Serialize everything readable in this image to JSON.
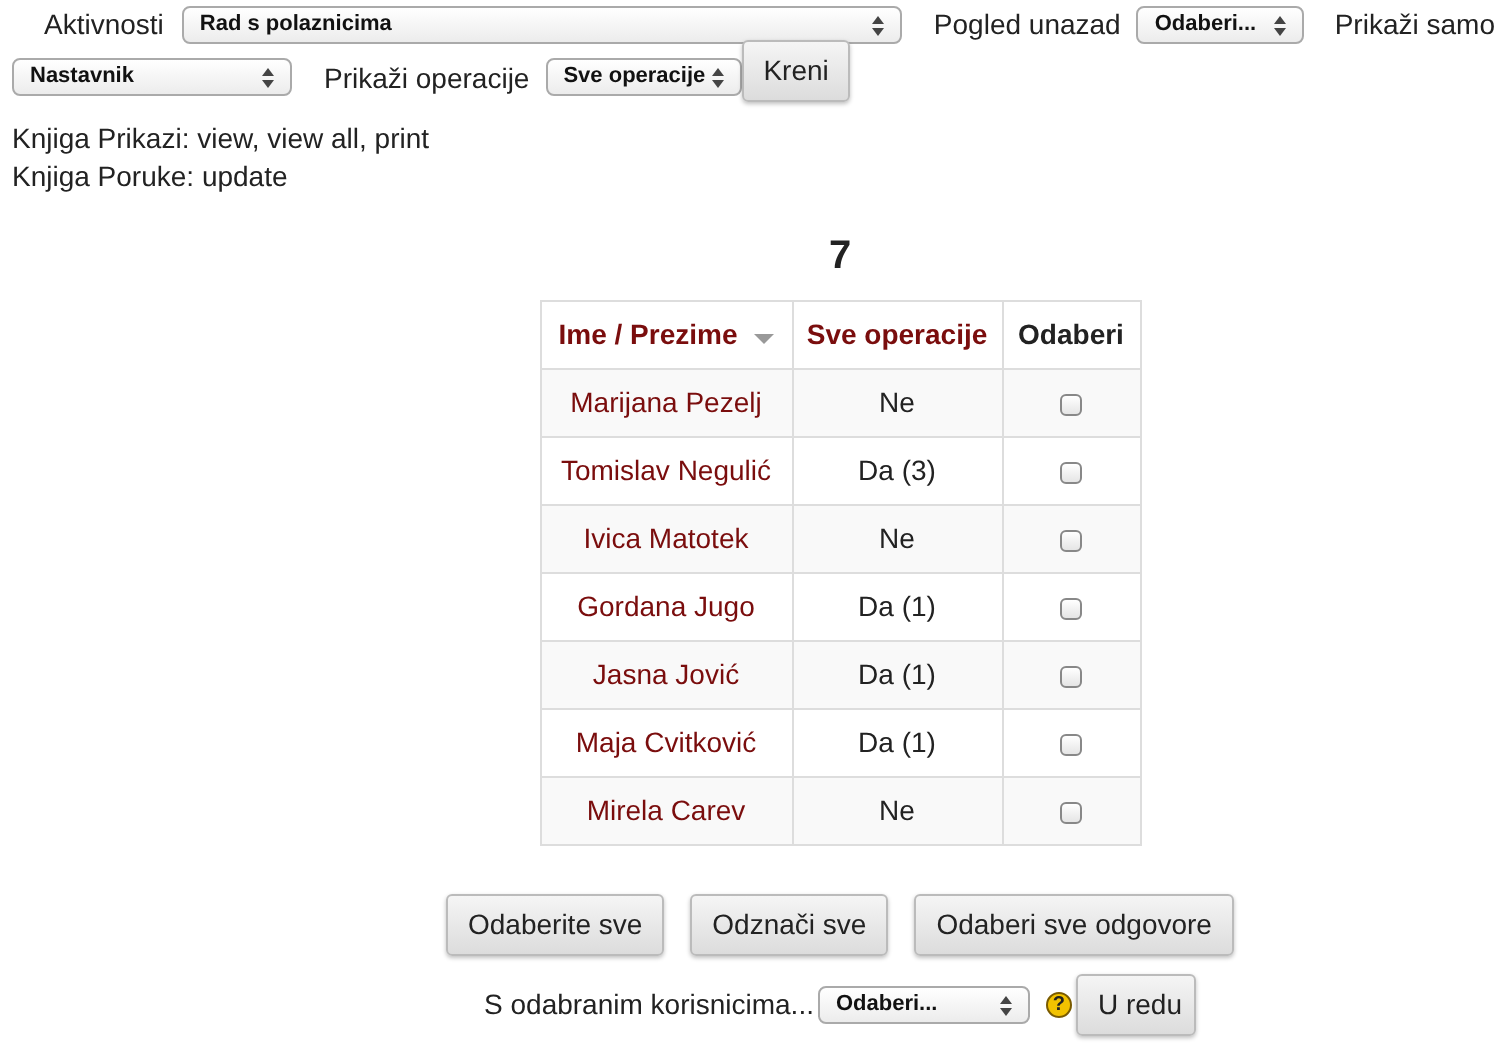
{
  "filters": {
    "activity_label": "Aktivnosti",
    "activity_value": "Rad s polaznicima",
    "lookback_label": "Pogled unazad",
    "lookback_value": "Odaberi...",
    "show_only_label": "Prikaži samo",
    "role_value": "Nastavnik",
    "operations_label": "Prikaži operacije",
    "operations_value": "Sve operacije",
    "go_button": "Kreni"
  },
  "info_lines": [
    "Knjiga Prikazi: view, view all, print",
    "Knjiga Poruke: update"
  ],
  "heading": "7",
  "table": {
    "columns": [
      {
        "label": "Ime / Prezime",
        "sorted": true,
        "link": true
      },
      {
        "label": "Sve operacije",
        "sorted": false,
        "link": true
      },
      {
        "label": "Odaberi",
        "sorted": false,
        "link": false
      }
    ],
    "rows": [
      {
        "name": "Marijana Pezelj",
        "operations": "Ne",
        "checked": false
      },
      {
        "name": "Tomislav Negulić",
        "operations": "Da (3)",
        "checked": false
      },
      {
        "name": "Ivica Matotek",
        "operations": "Ne",
        "checked": false
      },
      {
        "name": "Gordana Jugo",
        "operations": "Da (1)",
        "checked": false
      },
      {
        "name": "Jasna Jović",
        "operations": "Da (1)",
        "checked": false
      },
      {
        "name": "Maja Cvitković",
        "operations": "Da (1)",
        "checked": false
      },
      {
        "name": "Mirela Carev",
        "operations": "Ne",
        "checked": false
      }
    ]
  },
  "buttons": [
    "Odaberite sve",
    "Odznači sve",
    "Odaberi sve odgovore"
  ],
  "bulk_action": {
    "label": "S odabranim korisnicima...",
    "value": "Odaberi...",
    "help": "?",
    "button": "U redu"
  }
}
